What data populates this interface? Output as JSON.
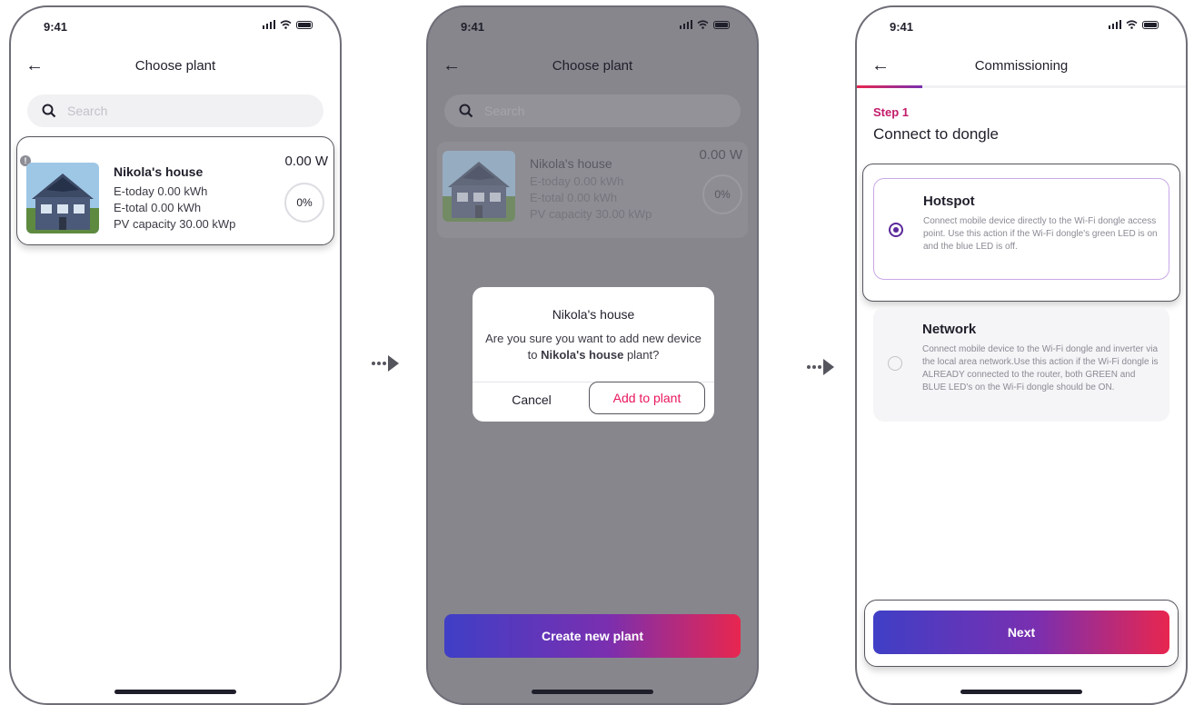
{
  "screen1": {
    "time": "9:41",
    "title": "Choose plant",
    "search_placeholder": "Search",
    "plant": {
      "name": "Nikola's house",
      "e_today": "E-today 0.00 kWh",
      "e_total": "E-total 0.00 kWh",
      "pv_capacity": "PV capacity 30.00 kWp",
      "power": "0.00 W",
      "percent": "0%"
    }
  },
  "screen2": {
    "time": "9:41",
    "title": "Choose plant",
    "search_placeholder": "Search",
    "plant": {
      "name": "Nikola's house",
      "e_today": "E-today 0.00 kWh",
      "e_total": "E-total 0.00 kWh",
      "pv_capacity": "PV capacity 30.00 kWp",
      "power": "0.00 W",
      "percent": "0%"
    },
    "dialog": {
      "title": "Nikola's house",
      "msg_before": "Are you sure you want to add new device to ",
      "msg_bold": "Nikola's house",
      "msg_after": " plant?",
      "cancel": "Cancel",
      "confirm": "Add to plant"
    },
    "create_button": "Create new plant"
  },
  "screen3": {
    "time": "9:41",
    "title": "Commissioning",
    "progress": 0.2,
    "step": "Step 1",
    "step_title": "Connect to dongle",
    "options": [
      {
        "name": "Hotspot",
        "selected": true,
        "description": "Connect mobile device directly to the Wi-Fi dongle access point. Use this action if the Wi-Fi dongle's green LED is on and the blue LED is off."
      },
      {
        "name": "Network",
        "selected": false,
        "description": "Connect mobile device to the Wi-Fi dongle and inverter via the local area network.Use this action if the Wi-Fi dongle is ALREADY connected to the router, both GREEN and BLUE LED's on the Wi-Fi dongle should be ON."
      }
    ],
    "next_button": "Next"
  },
  "colors": {
    "accent": "#e8175d",
    "gradient_start": "#3f3fc6",
    "gradient_end": "#e8264f",
    "step_color": "#c21a6a"
  }
}
